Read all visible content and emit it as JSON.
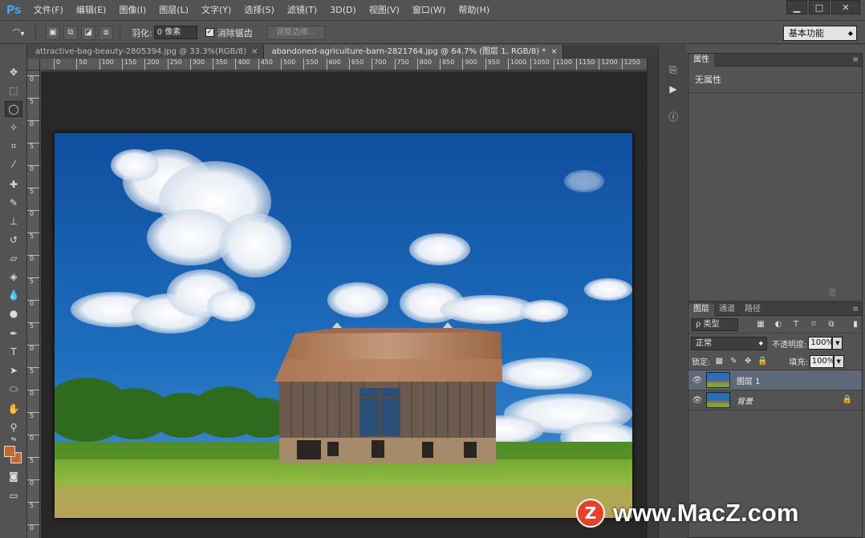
{
  "app": {
    "logo": "Ps"
  },
  "menu": [
    "文件(F)",
    "编辑(E)",
    "图像(I)",
    "图层(L)",
    "文字(Y)",
    "选择(S)",
    "滤镜(T)",
    "3D(D)",
    "视图(V)",
    "窗口(W)",
    "帮助(H)"
  ],
  "options": {
    "feather_label": "羽化:",
    "feather_value": "0 像素",
    "antialias_label": "消除锯齿",
    "refine_edge": "调整边缘...",
    "workspace": "基本功能"
  },
  "tabs": [
    {
      "label": "attractive-bag-beauty-2805394.jpg @ 33.3%(RGB/8)",
      "close": "×"
    },
    {
      "label": "abandoned-agriculture-barn-2821764.jpg @ 64.7% (图层 1, RGB/8) *",
      "close": "×"
    }
  ],
  "ruler_h": [
    "0",
    "50",
    "100",
    "150",
    "200",
    "250",
    "300",
    "350",
    "400",
    "450",
    "500",
    "550",
    "600",
    "650",
    "700",
    "750",
    "800",
    "850",
    "900",
    "950",
    "1000",
    "1050",
    "1100",
    "1150",
    "1200",
    "1250"
  ],
  "ruler_v": [
    "0",
    "5",
    "0",
    "5",
    "0",
    "5",
    "0",
    "5",
    "0",
    "5",
    "0",
    "5",
    "0",
    "5",
    "0",
    "5",
    "0",
    "5",
    "0",
    "5",
    "0"
  ],
  "properties": {
    "tab": "属性",
    "text": "无属性"
  },
  "layers_panel": {
    "tabs": [
      "图层",
      "通道",
      "路径"
    ],
    "filter_label": "ρ 类型",
    "blend_mode": "正常",
    "opacity_label": "不透明度:",
    "opacity_value": "100%",
    "lock_label": "锁定:",
    "fill_label": "填充:",
    "fill_value": "100%",
    "layers": [
      {
        "name": "图层 1",
        "selected": true
      },
      {
        "name": "背景",
        "selected": false
      }
    ]
  },
  "watermark": {
    "logo": "Z",
    "text": "www.MacZ.com"
  }
}
